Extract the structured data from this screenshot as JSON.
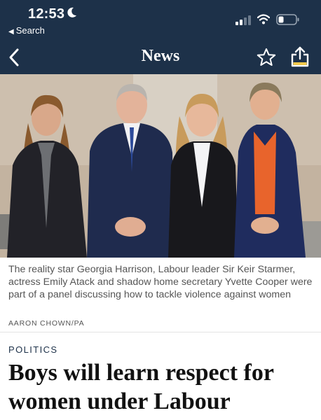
{
  "status_bar": {
    "time": "12:53",
    "back_label": "Search"
  },
  "nav": {
    "title": "News"
  },
  "article": {
    "caption": "The reality star Georgia Harrison, Labour leader Sir Keir Starmer, actress Emily Atack and shadow home secretary Yvette Cooper were part of a panel discussing how to tackle violence against women",
    "photo_credit": "AARON CHOWN/PA",
    "section": "POLITICS",
    "headline": "Boys will learn respect for women under Labour"
  },
  "colors": {
    "header_bg": "#1d3149",
    "share_accent": "#f2c94c",
    "battery_fill": "#ffffff"
  }
}
